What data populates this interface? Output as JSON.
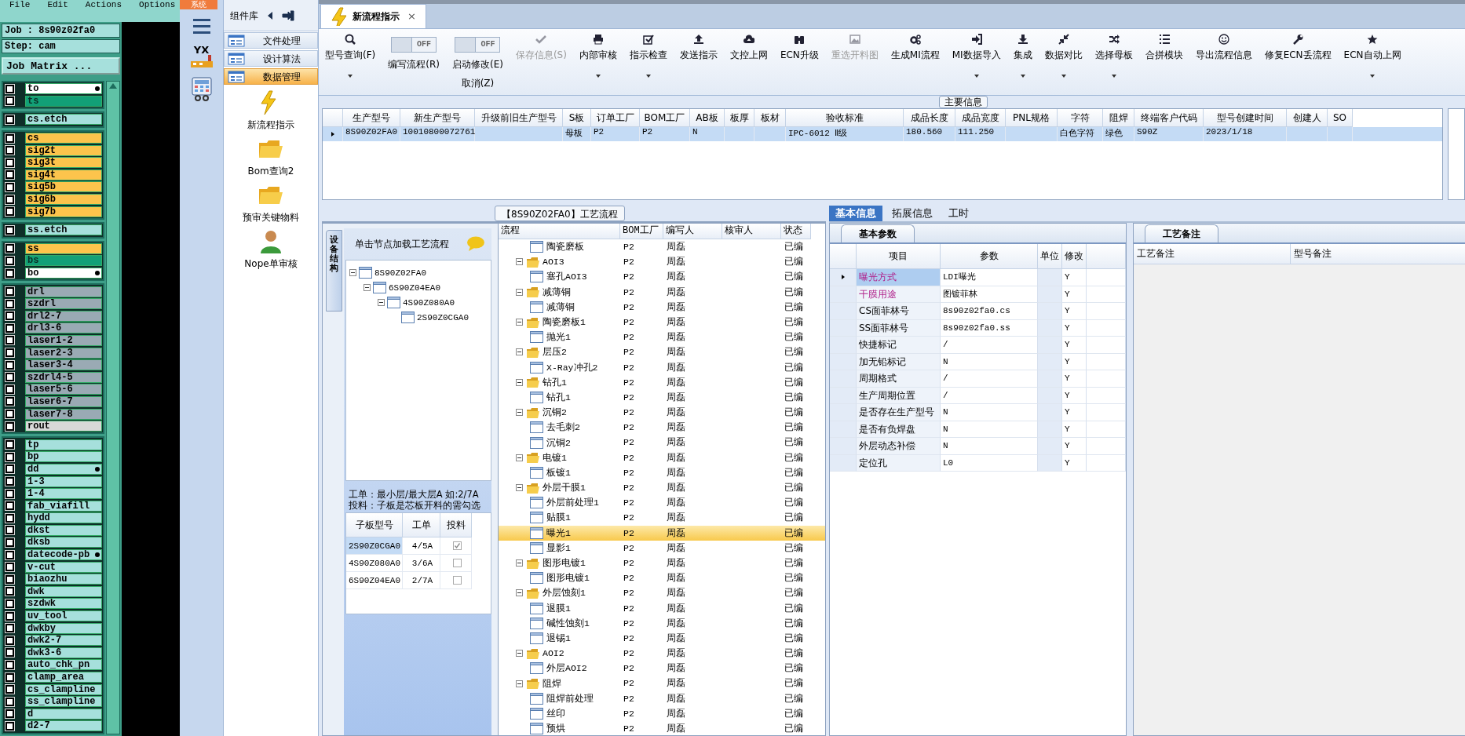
{
  "menu_bar": {
    "items": [
      "File",
      "Edit",
      "Actions",
      "Options"
    ]
  },
  "job_panel": {
    "job": "Job : 8s90z02fa0",
    "step": "Step: cam",
    "matrix_button": "Job Matrix ...",
    "layer_groups": [
      [
        {
          "name": "to",
          "color": "#ffffff",
          "checked": false,
          "flag": true
        },
        {
          "name": "ts",
          "color": "#12a077",
          "checked": false,
          "flag": false
        }
      ],
      [
        {
          "name": "cs.etch",
          "color": "#a6e0dc",
          "checked": false,
          "flag": false
        }
      ],
      [
        {
          "name": "cs",
          "color": "#fcc44c",
          "checked": false,
          "flag": false
        },
        {
          "name": "sig2t",
          "color": "#fcc44c",
          "checked": false,
          "flag": false
        },
        {
          "name": "sig3t",
          "color": "#fcc44c",
          "checked": false,
          "flag": false
        },
        {
          "name": "sig4t",
          "color": "#fcc44c",
          "checked": false,
          "flag": false
        },
        {
          "name": "sig5b",
          "color": "#fcc44c",
          "checked": false,
          "flag": false
        },
        {
          "name": "sig6b",
          "color": "#fcc44c",
          "checked": false,
          "flag": false
        },
        {
          "name": "sig7b",
          "color": "#fcc44c",
          "checked": false,
          "flag": false
        }
      ],
      [
        {
          "name": "ss.etch",
          "color": "#a6e0dc",
          "checked": false,
          "flag": false
        }
      ],
      [
        {
          "name": "ss",
          "color": "#fcc44c",
          "checked": false,
          "flag": false
        },
        {
          "name": "bs",
          "color": "#12a077",
          "checked": false,
          "flag": false
        },
        {
          "name": "bo",
          "color": "#ffffff",
          "checked": false,
          "flag": true
        }
      ],
      [
        {
          "name": "drl",
          "color": "#9aaab4",
          "checked": false,
          "flag": false
        },
        {
          "name": "szdrl",
          "color": "#9aaab4",
          "checked": false,
          "flag": false
        },
        {
          "name": "drl2-7",
          "color": "#9aaab4",
          "checked": false,
          "flag": false
        },
        {
          "name": "drl3-6",
          "color": "#9aaab4",
          "checked": false,
          "flag": false
        },
        {
          "name": "laser1-2",
          "color": "#9aaab4",
          "checked": false,
          "flag": false
        },
        {
          "name": "laser2-3",
          "color": "#9aaab4",
          "checked": false,
          "flag": false
        },
        {
          "name": "laser3-4",
          "color": "#9aaab4",
          "checked": false,
          "flag": false
        },
        {
          "name": "szdrl4-5",
          "color": "#9aaab4",
          "checked": false,
          "flag": false
        },
        {
          "name": "laser5-6",
          "color": "#9aaab4",
          "checked": false,
          "flag": false
        },
        {
          "name": "laser6-7",
          "color": "#9aaab4",
          "checked": false,
          "flag": false
        },
        {
          "name": "laser7-8",
          "color": "#9aaab4",
          "checked": false,
          "flag": false
        },
        {
          "name": "rout",
          "color": "#d8d8d8",
          "checked": false,
          "flag": false
        }
      ],
      [
        {
          "name": "tp",
          "color": "#a6e0dc",
          "checked": false,
          "flag": false
        },
        {
          "name": "bp",
          "color": "#a6e0dc",
          "checked": false,
          "flag": false
        },
        {
          "name": "dd",
          "color": "#a6e0dc",
          "checked": false,
          "flag": true
        },
        {
          "name": "1-3",
          "color": "#a6e0dc",
          "checked": false,
          "flag": false
        },
        {
          "name": "1-4",
          "color": "#a6e0dc",
          "checked": false,
          "flag": false
        },
        {
          "name": "fab_viafill",
          "color": "#a6e0dc",
          "checked": false,
          "flag": false
        },
        {
          "name": "hydd",
          "color": "#a6e0dc",
          "checked": false,
          "flag": false
        },
        {
          "name": "dkst",
          "color": "#a6e0dc",
          "checked": false,
          "flag": false
        },
        {
          "name": "dksb",
          "color": "#a6e0dc",
          "checked": false,
          "flag": false
        },
        {
          "name": "datecode-pb",
          "color": "#a6e0dc",
          "checked": false,
          "flag": true
        },
        {
          "name": "v-cut",
          "color": "#a6e0dc",
          "checked": false,
          "flag": false
        },
        {
          "name": "biaozhu",
          "color": "#a6e0dc",
          "checked": false,
          "flag": false
        },
        {
          "name": "dwk",
          "color": "#a6e0dc",
          "checked": false,
          "flag": false
        },
        {
          "name": "szdwk",
          "color": "#a6e0dc",
          "checked": false,
          "flag": false
        },
        {
          "name": "uv_tool",
          "color": "#a6e0dc",
          "checked": false,
          "flag": false
        },
        {
          "name": "dwkby",
          "color": "#a6e0dc",
          "checked": false,
          "flag": false
        },
        {
          "name": "dwk2-7",
          "color": "#a6e0dc",
          "checked": false,
          "flag": false
        },
        {
          "name": "dwk3-6",
          "color": "#a6e0dc",
          "checked": false,
          "flag": false
        },
        {
          "name": "auto_chk_pn",
          "color": "#a6e0dc",
          "checked": false,
          "flag": false
        },
        {
          "name": "clamp_area",
          "color": "#a6e0dc",
          "checked": false,
          "flag": false
        },
        {
          "name": "cs_clampline",
          "color": "#a6e0dc",
          "checked": false,
          "flag": false
        },
        {
          "name": "ss_clampline",
          "color": "#a6e0dc",
          "checked": false,
          "flag": false
        },
        {
          "name": "d",
          "color": "#a6e0dc",
          "checked": false,
          "flag": false
        },
        {
          "name": "d2-7",
          "color": "#a6e0dc",
          "checked": false,
          "flag": false
        }
      ]
    ]
  },
  "side_strip": {
    "top_tab": "系统",
    "logo_text": "YX"
  },
  "component_library": {
    "title": "组件库",
    "categories": [
      {
        "label": "文件处理",
        "selected": false
      },
      {
        "label": "设计算法",
        "selected": false
      },
      {
        "label": "数据管理",
        "selected": true
      }
    ],
    "tools": [
      "新流程指示",
      "Bom查询2",
      "预审关键物料",
      "Nope单审核"
    ]
  },
  "document_tabs": [
    {
      "label": "新流程指示",
      "close": "×",
      "selected": true
    }
  ],
  "toolbar": {
    "items": [
      {
        "kind": "button",
        "label": "型号查询(F)",
        "dropdown": true,
        "disabled": false
      },
      {
        "kind": "toggle",
        "label": "编写流程(R)",
        "state_text": "OFF",
        "on": false
      },
      {
        "kind": "toggle",
        "label": "启动修改(E)",
        "sublabel": "取消(Z)",
        "state_text": "OFF",
        "on": false
      },
      {
        "kind": "button",
        "label": "保存信息(S)",
        "dropdown": false,
        "disabled": true
      },
      {
        "kind": "button",
        "label": "内部审核",
        "dropdown": true,
        "disabled": false
      },
      {
        "kind": "button",
        "label": "指示检查",
        "dropdown": true,
        "disabled": false
      },
      {
        "kind": "button",
        "label": "发送指示",
        "dropdown": false,
        "disabled": false
      },
      {
        "kind": "button",
        "label": "文控上网",
        "dropdown": false,
        "disabled": false
      },
      {
        "kind": "button",
        "label": "ECN升级",
        "dropdown": false,
        "disabled": false
      },
      {
        "kind": "button",
        "label": "重选开料图",
        "dropdown": false,
        "disabled": true
      },
      {
        "kind": "button",
        "label": "生成MI流程",
        "dropdown": false,
        "disabled": false
      },
      {
        "kind": "button",
        "label": "MI数据导入",
        "dropdown": true,
        "disabled": false
      },
      {
        "kind": "button",
        "label": "集成",
        "dropdown": true,
        "disabled": false
      },
      {
        "kind": "button",
        "label": "数据对比",
        "dropdown": true,
        "disabled": false
      },
      {
        "kind": "button",
        "label": "选择母板",
        "dropdown": true,
        "disabled": false
      },
      {
        "kind": "button",
        "label": "合拼模块",
        "dropdown": false,
        "disabled": false
      },
      {
        "kind": "button",
        "label": "导出流程信息",
        "dropdown": false,
        "disabled": false
      },
      {
        "kind": "button",
        "label": "修复ECN丢流程",
        "dropdown": false,
        "disabled": false
      },
      {
        "kind": "button",
        "label": "ECN自动上网",
        "dropdown": true,
        "disabled": false
      }
    ]
  },
  "main_info": {
    "title": "主要信息",
    "columns": [
      "生产型号",
      "新生产型号",
      "升级前旧生产型号",
      "S板",
      "订单工厂",
      "BOM工厂",
      "AB板",
      "板厚",
      "板材",
      "验收标准",
      "成品长度",
      "成品宽度",
      "PNL规格",
      "字符",
      "阻焊",
      "终端客户代码",
      "型号创建时间",
      "创建人",
      "SO"
    ],
    "rows": [
      {
        "selected": true,
        "cells": [
          "8S90Z02FA0",
          "10010800072761",
          null,
          "母板",
          "P2",
          "P2",
          "N",
          null,
          null,
          "IPC-6012 Ⅱ级",
          "180.560",
          "111.250",
          null,
          "白色字符",
          "绿色",
          "S90Z",
          "2023/1/18",
          null,
          null
        ]
      }
    ]
  },
  "process_flow": {
    "title": "【8S90Z02FA0】工艺流程",
    "side_tab": "设备结构",
    "tree_hint": "单击节点加载工艺流程",
    "tree": [
      {
        "label": "8S90Z02FA0",
        "expanded": true,
        "children": [
          {
            "label": "6S90Z04EA0",
            "expanded": true,
            "children": [
              {
                "label": "4S90Z080A0",
                "expanded": true,
                "children": [
                  {
                    "label": "2S90Z0CGA0"
                  }
                ]
              }
            ]
          }
        ]
      }
    ],
    "notes": [
      "工单：最小层/最大层A 如:2/7A",
      "投料：子板是芯板开料的需勾选"
    ],
    "sub_boards": {
      "columns": [
        "子板型号",
        "工单",
        "投料"
      ],
      "rows": [
        {
          "board": "2S90Z0CGA0",
          "order": "4/5A",
          "feed": true,
          "selected": true
        },
        {
          "board": "4S90Z080A0",
          "order": "3/6A",
          "feed": false,
          "selected": false
        },
        {
          "board": "6S90Z04EA0",
          "order": "2/7A",
          "feed": false,
          "selected": false
        }
      ]
    },
    "steps": {
      "columns": [
        "流程",
        "BOM工厂",
        "编写人",
        "核审人",
        "状态"
      ],
      "rows": [
        {
          "children": [
            {
              "label": "陶瓷磨板",
              "bom": "P2",
              "writer": "周磊",
              "status": "已编",
              "selected": false
            }
          ]
        },
        {
          "label": "AOI3",
          "bom": "P2",
          "writer": "周磊",
          "status": "已编",
          "expanded": true,
          "selected": false,
          "children": [
            {
              "label": "塞孔AOI3",
              "bom": "P2",
              "writer": "周磊",
              "status": "已编",
              "selected": false
            }
          ]
        },
        {
          "label": "减薄铜",
          "bom": "P2",
          "writer": "周磊",
          "status": "已编",
          "expanded": true,
          "selected": false,
          "children": [
            {
              "label": "减薄铜",
              "bom": "P2",
              "writer": "周磊",
              "status": "已编",
              "selected": false
            }
          ]
        },
        {
          "label": "陶瓷磨板1",
          "bom": "P2",
          "writer": "周磊",
          "status": "已编",
          "expanded": true,
          "selected": false,
          "children": [
            {
              "label": "抛光1",
              "bom": "P2",
              "writer": "周磊",
              "status": "已编",
              "selected": false
            }
          ]
        },
        {
          "label": "层压2",
          "bom": "P2",
          "writer": "周磊",
          "status": "已编",
          "expanded": true,
          "selected": false,
          "children": [
            {
              "label": "X-Ray冲孔2",
              "bom": "P2",
              "writer": "周磊",
              "status": "已编",
              "selected": false
            }
          ]
        },
        {
          "label": "钻孔1",
          "bom": "P2",
          "writer": "周磊",
          "status": "已编",
          "expanded": true,
          "selected": false,
          "children": [
            {
              "label": "钻孔1",
              "bom": "P2",
              "writer": "周磊",
              "status": "已编",
              "selected": false
            }
          ]
        },
        {
          "label": "沉铜2",
          "bom": "P2",
          "writer": "周磊",
          "status": "已编",
          "expanded": true,
          "selected": false,
          "children": [
            {
              "label": "去毛刺2",
              "bom": "P2",
              "writer": "周磊",
              "status": "已编",
              "selected": false
            },
            {
              "label": "沉铜2",
              "bom": "P2",
              "writer": "周磊",
              "status": "已编",
              "selected": false
            }
          ]
        },
        {
          "label": "电镀1",
          "bom": "P2",
          "writer": "周磊",
          "status": "已编",
          "expanded": true,
          "selected": false,
          "children": [
            {
              "label": "板镀1",
              "bom": "P2",
              "writer": "周磊",
              "status": "已编",
              "selected": false
            }
          ]
        },
        {
          "label": "外层干膜1",
          "bom": "P2",
          "writer": "周磊",
          "status": "已编",
          "expanded": true,
          "selected": false,
          "children": [
            {
              "label": "外层前处理1",
              "bom": "P2",
              "writer": "周磊",
              "status": "已编",
              "selected": false
            },
            {
              "label": "贴膜1",
              "bom": "P2",
              "writer": "周磊",
              "status": "已编",
              "selected": false
            },
            {
              "label": "曝光1",
              "bom": "P2",
              "writer": "周磊",
              "status": "已编",
              "selected": true
            },
            {
              "label": "显影1",
              "bom": "P2",
              "writer": "周磊",
              "status": "已编",
              "selected": false
            }
          ]
        },
        {
          "label": "图形电镀1",
          "bom": "P2",
          "writer": "周磊",
          "status": "已编",
          "expanded": true,
          "selected": false,
          "children": [
            {
              "label": "图形电镀1",
              "bom": "P2",
              "writer": "周磊",
              "status": "已编",
              "selected": false
            }
          ]
        },
        {
          "label": "外层蚀刻1",
          "bom": "P2",
          "writer": "周磊",
          "status": "已编",
          "expanded": true,
          "selected": false,
          "children": [
            {
              "label": "退膜1",
              "bom": "P2",
              "writer": "周磊",
              "status": "已编",
              "selected": false
            },
            {
              "label": "碱性蚀刻1",
              "bom": "P2",
              "writer": "周磊",
              "status": "已编",
              "selected": false
            },
            {
              "label": "退锡1",
              "bom": "P2",
              "writer": "周磊",
              "status": "已编",
              "selected": false
            }
          ]
        },
        {
          "label": "AOI2",
          "bom": "P2",
          "writer": "周磊",
          "status": "已编",
          "expanded": true,
          "selected": false,
          "children": [
            {
              "label": "外层AOI2",
              "bom": "P2",
              "writer": "周磊",
              "status": "已编",
              "selected": false
            }
          ]
        },
        {
          "label": "阻焊",
          "bom": "P2",
          "writer": "周磊",
          "status": "已编",
          "expanded": true,
          "selected": false,
          "children": [
            {
              "label": "阻焊前处理",
              "bom": "P2",
              "writer": "周磊",
              "status": "已编",
              "selected": false
            },
            {
              "label": "丝印",
              "bom": "P2",
              "writer": "周磊",
              "status": "已编",
              "selected": false
            },
            {
              "label": "预烘",
              "bom": "P2",
              "writer": "周磊",
              "status": "已编",
              "selected": false
            }
          ]
        }
      ]
    }
  },
  "detail_tabs": [
    {
      "label": "基本信息",
      "selected": true
    },
    {
      "label": "拓展信息",
      "selected": false
    },
    {
      "label": "工时",
      "selected": false
    }
  ],
  "basic_params": {
    "tab": "基本参数",
    "columns": [
      "项目",
      "参数",
      "单位",
      "修改"
    ],
    "rows": [
      {
        "item": "曝光方式",
        "value": "LDI曝光",
        "modified": "Y",
        "highlight": true,
        "selected": true
      },
      {
        "item": "干膜用途",
        "value": "图镀菲林",
        "modified": "Y",
        "highlight": true,
        "selected": false
      },
      {
        "item": "CS面菲林号",
        "value": "8s90z02fa0.cs",
        "modified": "Y",
        "highlight": false,
        "selected": false
      },
      {
        "item": "SS面菲林号",
        "value": "8s90z02fa0.ss",
        "modified": "Y",
        "highlight": false,
        "selected": false
      },
      {
        "item": "快捷标记",
        "value": "/",
        "modified": "Y",
        "highlight": false,
        "selected": false
      },
      {
        "item": "加无铅标记",
        "value": "N",
        "modified": "Y",
        "highlight": false,
        "selected": false
      },
      {
        "item": "周期格式",
        "value": "/",
        "modified": "Y",
        "highlight": false,
        "selected": false
      },
      {
        "item": "生产周期位置",
        "value": "/",
        "modified": "Y",
        "highlight": false,
        "selected": false
      },
      {
        "item": "是否存在生产型号",
        "value": "N",
        "modified": "Y",
        "highlight": false,
        "selected": false
      },
      {
        "item": "是否有负焊盘",
        "value": "N",
        "modified": "Y",
        "highlight": false,
        "selected": false
      },
      {
        "item": "外层动态补偿",
        "value": "N",
        "modified": "Y",
        "highlight": false,
        "selected": false
      },
      {
        "item": "定位孔",
        "value": "L0",
        "modified": "Y",
        "highlight": false,
        "selected": false
      }
    ]
  },
  "process_notes": {
    "tab": "工艺备注",
    "columns": [
      "工艺备注",
      "型号备注"
    ]
  }
}
